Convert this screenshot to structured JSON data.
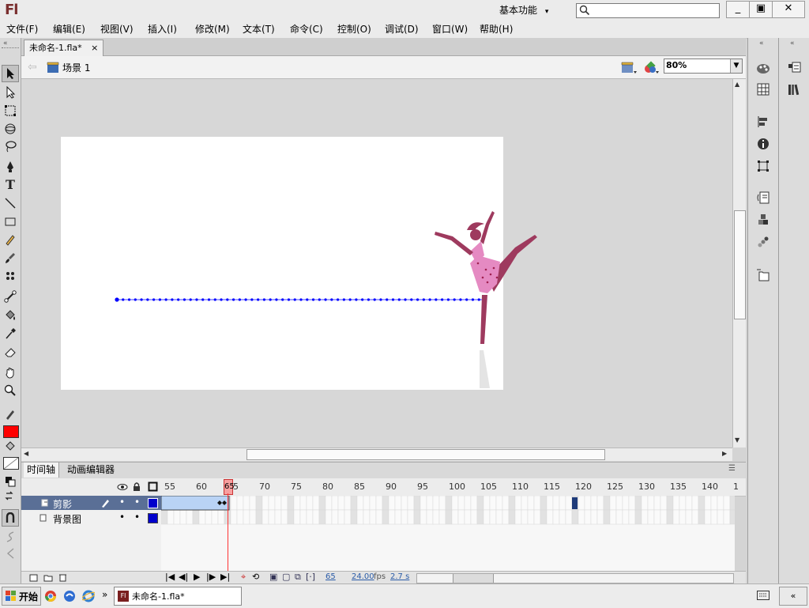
{
  "app": {
    "logo": "Fl",
    "workspace": "基本功能",
    "search": {
      "value": "",
      "placeholder": ""
    },
    "window_buttons": [
      "_",
      "▣",
      "✕"
    ]
  },
  "menubar": [
    "文件(F)",
    "编辑(E)",
    "视图(V)",
    "插入(I)",
    "修改(M)",
    "文本(T)",
    "命令(C)",
    "控制(O)",
    "调试(D)",
    "窗口(W)",
    "帮助(H)"
  ],
  "document": {
    "tab_label": "未命名-1.fla*",
    "tab_close": "×",
    "scene": "场景 1",
    "zoom": "80%"
  },
  "timeline": {
    "tabs": [
      "时间轴",
      "动画编辑器"
    ],
    "frame_numbers": [
      "55",
      "60",
      "65",
      "70",
      "75",
      "80",
      "85",
      "90",
      "95",
      "100",
      "105",
      "110",
      "115",
      "120",
      "125",
      "130",
      "135",
      "140",
      "1"
    ],
    "current_frame_marker": "65",
    "layers": [
      {
        "name": "剪影",
        "selected": true
      },
      {
        "name": "背景图",
        "selected": false
      }
    ],
    "status": {
      "frame": "65",
      "fps": "24.00",
      "fps_unit": "fps",
      "time": "2.7 s"
    }
  },
  "taskbar": {
    "start": "开始",
    "task": "未命名-1.fla*",
    "more": "»"
  },
  "colors": {
    "stroke_color": "#000000",
    "fill_color": "#ff0000",
    "layer_outline": "#0000cc",
    "motion_path": "#0000ff",
    "playhead": "#ff3333",
    "tween_fill": "#b9d3f5",
    "figure_dark": "#9e3a5e",
    "figure_light": "#e58ac2"
  }
}
